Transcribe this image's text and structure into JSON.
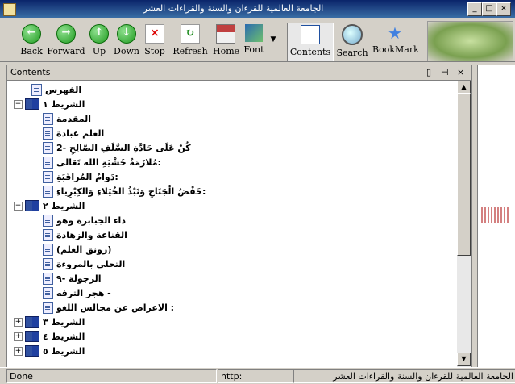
{
  "window": {
    "title": "الجامعة العالمية للقرءان والسنة والقراءات العشر"
  },
  "toolbar": {
    "back": "Back",
    "forward": "Forward",
    "up": "Up",
    "down": "Down",
    "stop": "Stop",
    "refresh": "Refresh",
    "home": "Home",
    "font": "Font",
    "contents": "Contents",
    "search": "Search",
    "bookmark": "BookMark"
  },
  "pane": {
    "title": "Contents"
  },
  "tree": [
    {
      "label": "الفهرس"
    },
    {
      "label": "الشريط ١"
    },
    {
      "label": "المقدمة"
    },
    {
      "label": "العلم عبادة"
    },
    {
      "label": "كُنْ عَلَى جَادَّةِ السَّلَفِ الصَّالِحِ -2"
    },
    {
      "label": "مُلازَمَةُ خَشْيَةِ الله تَعَالى:"
    },
    {
      "label": "دَوامُ المُراقَبَةِ:"
    },
    {
      "label": "خَفْضُ الْجَنَاحِ وَنَبْذُ الخُيَلاءِ وَالكِبْرِياءِ:"
    },
    {
      "label": "الشريط ٢"
    },
    {
      "label": "داء الجبابرة وهو"
    },
    {
      "label": "القناعة والزهادة"
    },
    {
      "label": "(رونق العلم)"
    },
    {
      "label": "التحلي بالمروءة"
    },
    {
      "label": "الرجولة -٩"
    },
    {
      "label": "هجر الترفه -"
    },
    {
      "label": "الاعراض عن مجالس اللغو :"
    },
    {
      "label": "الشريط ٣"
    },
    {
      "label": "الشريط ٤"
    },
    {
      "label": "الشريط ٥"
    }
  ],
  "status": {
    "left": "Done",
    "middle": "http:",
    "right": "الجامعة العالمية للقرءان والسنة والقراءات العشر"
  }
}
